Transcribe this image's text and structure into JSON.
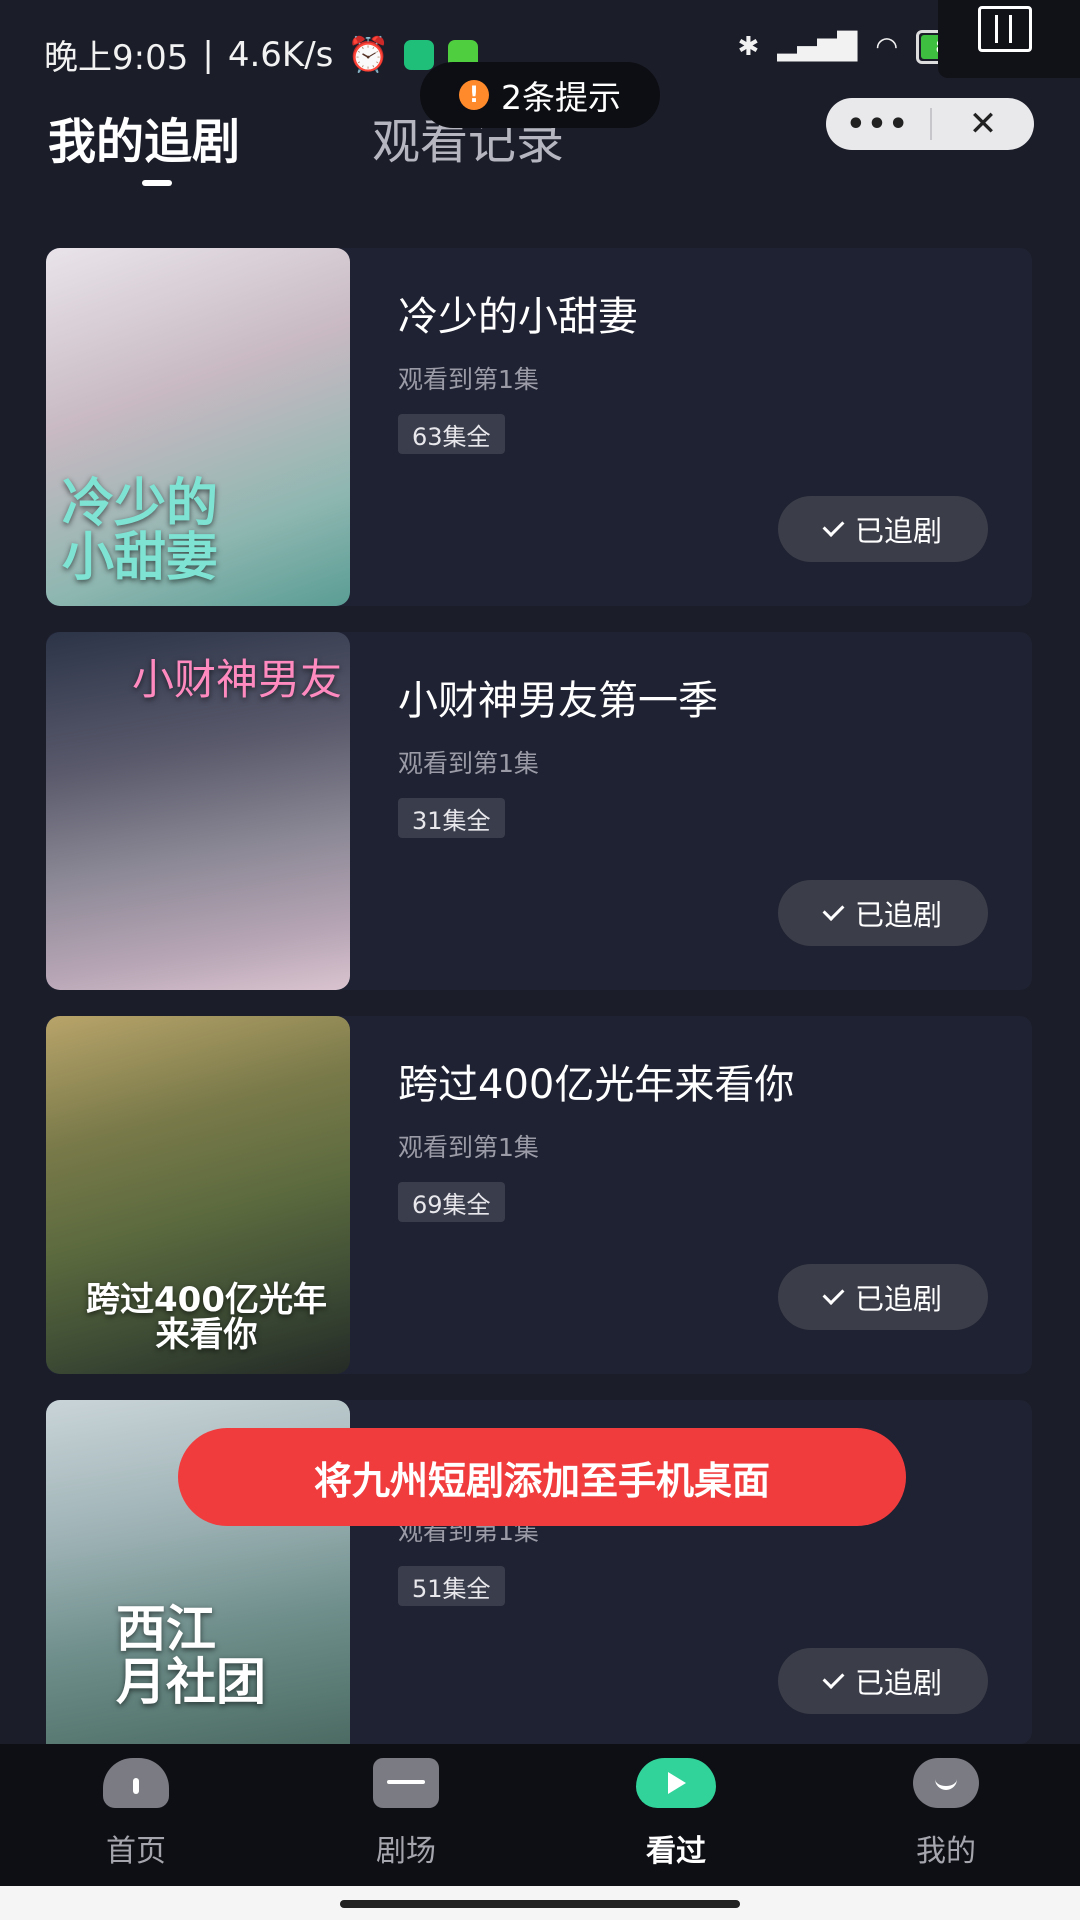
{
  "status_bar": {
    "time": "晚上9:05",
    "net_speed": "4.6K/s",
    "battery": "81",
    "battery_level": 0.81
  },
  "notice": {
    "text": "2条提示"
  },
  "tabs": [
    {
      "label": "我的追剧",
      "active": true
    },
    {
      "label": "观看记录",
      "active": false
    }
  ],
  "capsule": {
    "more": "•••",
    "close": "✕"
  },
  "dramas": [
    {
      "title": "冷少的小甜妻",
      "progress": "观看到第1集",
      "episodes": "63集全",
      "status": "已追剧",
      "poster_text": "冷少的\n小甜妻"
    },
    {
      "title": "小财神男友第一季",
      "progress": "观看到第1集",
      "episodes": "31集全",
      "status": "已追剧",
      "poster_text": "小财神男友"
    },
    {
      "title": "跨过400亿光年来看你",
      "progress": "观看到第1集",
      "episodes": "69集全",
      "status": "已追剧",
      "poster_text": "跨过400亿光年\n来看你"
    },
    {
      "title": "",
      "progress": "观看到第1集",
      "episodes": "51集全",
      "status": "已追剧",
      "poster_text": "西江\n月社团"
    }
  ],
  "toast": {
    "text": "将九州短剧添加至手机桌面"
  },
  "bottom_nav": [
    {
      "label": "首页",
      "icon": "home-icon",
      "active": false
    },
    {
      "label": "剧场",
      "icon": "tv-icon",
      "active": false
    },
    {
      "label": "看过",
      "icon": "watched-icon",
      "active": true
    },
    {
      "label": "我的",
      "icon": "profile-icon",
      "active": false
    }
  ]
}
